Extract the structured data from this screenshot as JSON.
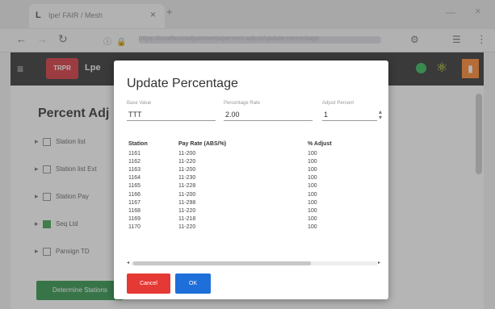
{
  "browser": {
    "tab_title": "Ipe! FAIR / Mesh",
    "favicon": "L",
    "url": "https://localhost/adjustments/percent-adjust/update-percentage"
  },
  "app": {
    "brand_label": "TRPR",
    "title": "Lpe",
    "status_color": "#1fb04a"
  },
  "page": {
    "title": "Percent Adj",
    "rows": [
      {
        "label": "Station list",
        "checked": false
      },
      {
        "label": "Station list Ext",
        "checked": false
      },
      {
        "label": "Station Pay",
        "checked": false
      },
      {
        "label": "Seq Ltd",
        "checked": true
      },
      {
        "label": "Pansign TD",
        "checked": false
      }
    ],
    "determine_label": "Determine Stations"
  },
  "modal": {
    "title": "Update Percentage",
    "fields": [
      {
        "label": "Base Value",
        "value": "TTT"
      },
      {
        "label": "Percentage Rate",
        "value": "2.00"
      },
      {
        "label": "Adjust Percent",
        "value": "1"
      }
    ],
    "table": {
      "columns": [
        "Station",
        "Pay Rate (ABS/%)",
        "% Adjust"
      ],
      "rows": [
        [
          "1161",
          "11-200",
          "100"
        ],
        [
          "1162",
          "11-220",
          "100"
        ],
        [
          "1163",
          "11-200",
          "100"
        ],
        [
          "1164",
          "11-230",
          "100"
        ],
        [
          "1165",
          "11-228",
          "100"
        ],
        [
          "1166",
          "11-200",
          "100"
        ],
        [
          "1167",
          "11-298",
          "100"
        ],
        [
          "1168",
          "11-220",
          "100"
        ],
        [
          "1169",
          "11-218",
          "100"
        ],
        [
          "1170",
          "11-220",
          "100"
        ]
      ]
    },
    "cancel_label": "Cancel",
    "ok_label": "OK"
  }
}
